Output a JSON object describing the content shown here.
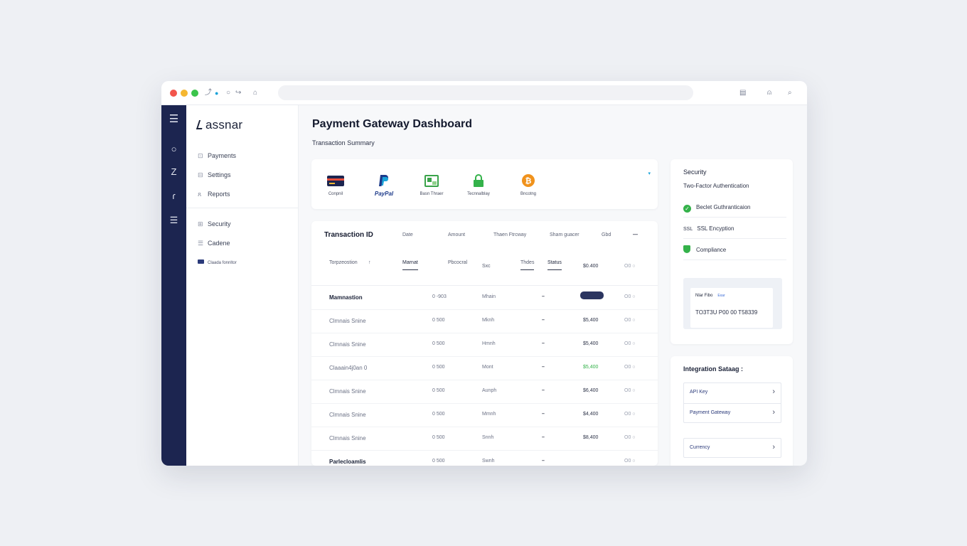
{
  "window": {
    "traffic": [
      "#f2554c",
      "#f5b731",
      "#3bc44b"
    ],
    "toolbar_icons": [
      "back-arrow-icon",
      "refresh-icon",
      "circle-icon",
      "forward-icon",
      "home-icon"
    ],
    "right_icons": [
      "calendar-icon",
      "bell-icon",
      "search-icon"
    ]
  },
  "rail": {
    "icons": [
      "menu-icon",
      "circle-icon",
      "z-icon",
      "r-icon",
      "lines-icon"
    ]
  },
  "sidebar": {
    "brand": "assnar",
    "nav_top": [
      {
        "label": "Payments",
        "icon": "payments-icon"
      },
      {
        "label": "Settings",
        "icon": "settings-icon"
      },
      {
        "label": "Reports",
        "icon": "user-icon"
      }
    ],
    "nav_bottom": [
      {
        "label": "Security",
        "icon": "lock-icon"
      },
      {
        "label": "Cadene",
        "icon": "list-icon"
      },
      {
        "label": "Claada fonnltor",
        "icon": "card-icon"
      }
    ]
  },
  "main": {
    "title": "Payment Gateway Dashboard",
    "subtitle": "Transaction Summary",
    "methods": [
      {
        "label": "Conpnil",
        "icon": "credit-card-icon",
        "color": "#1c2550"
      },
      {
        "label": "PayPal",
        "icon": "paypal-icon",
        "color": "#1c3a8a"
      },
      {
        "label": "Basn Thraer",
        "icon": "bank-transfer-icon",
        "color": "#3aa34a"
      },
      {
        "label": "Tecnnalblay",
        "icon": "lock-icon",
        "color": "#34b24a"
      },
      {
        "label": "Bncotng",
        "icon": "bitcoin-icon",
        "color": "#f0921c"
      }
    ],
    "table": {
      "headers": [
        "Transaction ID",
        "Date",
        "Amount",
        "Thaen Ftrcway",
        "Sham guacer",
        "Gbd",
        "—"
      ],
      "filters": [
        "Torpzeostion",
        "↑",
        "Marnat",
        "Pbcocral",
        "Sxc",
        "Thdes",
        "Status",
        "$0.400",
        "O0"
      ],
      "rows": [
        {
          "id": "Mamnastion",
          "date": "0 -903",
          "amount": "Mhain",
          "dash": "–",
          "value": "",
          "pill": true,
          "act": "O0",
          "strong": true,
          "green": false
        },
        {
          "id": "Clmnais Snine",
          "date": "0 500",
          "amount": "Mknh",
          "dash": "–",
          "value": "$5,400",
          "pill": false,
          "act": "O0",
          "strong": false,
          "green": false
        },
        {
          "id": "Clmnais Snine",
          "date": "0 500",
          "amount": "Hmnh",
          "dash": "–",
          "value": "$5,400",
          "pill": false,
          "act": "O0",
          "strong": false,
          "green": false
        },
        {
          "id": "Claaain4j0an 0",
          "date": "0 500",
          "amount": "Mont",
          "dash": "–",
          "value": "$5,400",
          "pill": false,
          "act": "O0",
          "strong": false,
          "green": true
        },
        {
          "id": "Clmnais Snine",
          "date": "0 500",
          "amount": "Aunph",
          "dash": "–",
          "value": "$6,400",
          "pill": false,
          "act": "O0",
          "strong": false,
          "green": false
        },
        {
          "id": "Clmnais Snine",
          "date": "0 500",
          "amount": "Mmnh",
          "dash": "–",
          "value": "$4,400",
          "pill": false,
          "act": "O0",
          "strong": false,
          "green": false
        },
        {
          "id": "Clmnais Snine",
          "date": "0 500",
          "amount": "Snnh",
          "dash": "–",
          "value": "$8,400",
          "pill": false,
          "act": "O0",
          "strong": false,
          "green": false
        },
        {
          "id": "Parlecloamlis",
          "date": "0 500",
          "amount": "Swnh",
          "dash": "–",
          "value": "",
          "pill": false,
          "act": "O0",
          "strong": true,
          "green": false
        }
      ]
    }
  },
  "security": {
    "title": "Security",
    "subtitle": "Two-Factor Authentication",
    "items": [
      {
        "label": "Beclet Guthranticaion",
        "icon": "check-circle-icon"
      },
      {
        "label": "SSL Encyption",
        "icon": "ssl-icon",
        "prefix": "SSL"
      },
      {
        "label": "Compliance",
        "icon": "shield-icon"
      }
    ],
    "note_label": "Nlar Fibo",
    "note_link": "Exar",
    "note_number": "TO3T3U P00 00 T58339"
  },
  "integration": {
    "title": "Integration Sataag :",
    "items": [
      "API Key",
      "Payment Gateway",
      "Currency"
    ]
  }
}
